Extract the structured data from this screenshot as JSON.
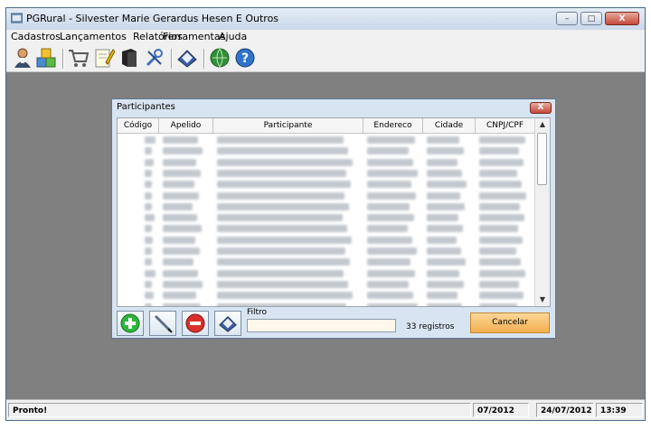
{
  "window": {
    "title": "PGRural - Silvester Marie Gerardus Hesen E Outros",
    "minimize": "–",
    "maximize": "□",
    "close": "X"
  },
  "menu": [
    "Cadastros",
    "Lançamentos",
    "Relatórios",
    "Ferramentas",
    "Ajuda"
  ],
  "toolbar_icons": [
    "people-icon",
    "boxes-icon",
    "cart-icon",
    "notepad-icon",
    "book-icon",
    "tools-icon",
    "eraser-icon",
    "globe-icon",
    "help-icon"
  ],
  "dialog": {
    "title": "Participantes",
    "close": "X",
    "columns": [
      "Código",
      "Apelido",
      "Participante",
      "Endereco",
      "Cidade",
      "CNPJ/CPF"
    ],
    "row_count_visible": 16,
    "filter_label": "Filtro",
    "filter_value": "",
    "records": "33 registros",
    "cancel": "Cancelar"
  },
  "status": {
    "text": "Pronto!",
    "period": "07/2012",
    "date": "24/07/2012",
    "time": "13:39"
  }
}
